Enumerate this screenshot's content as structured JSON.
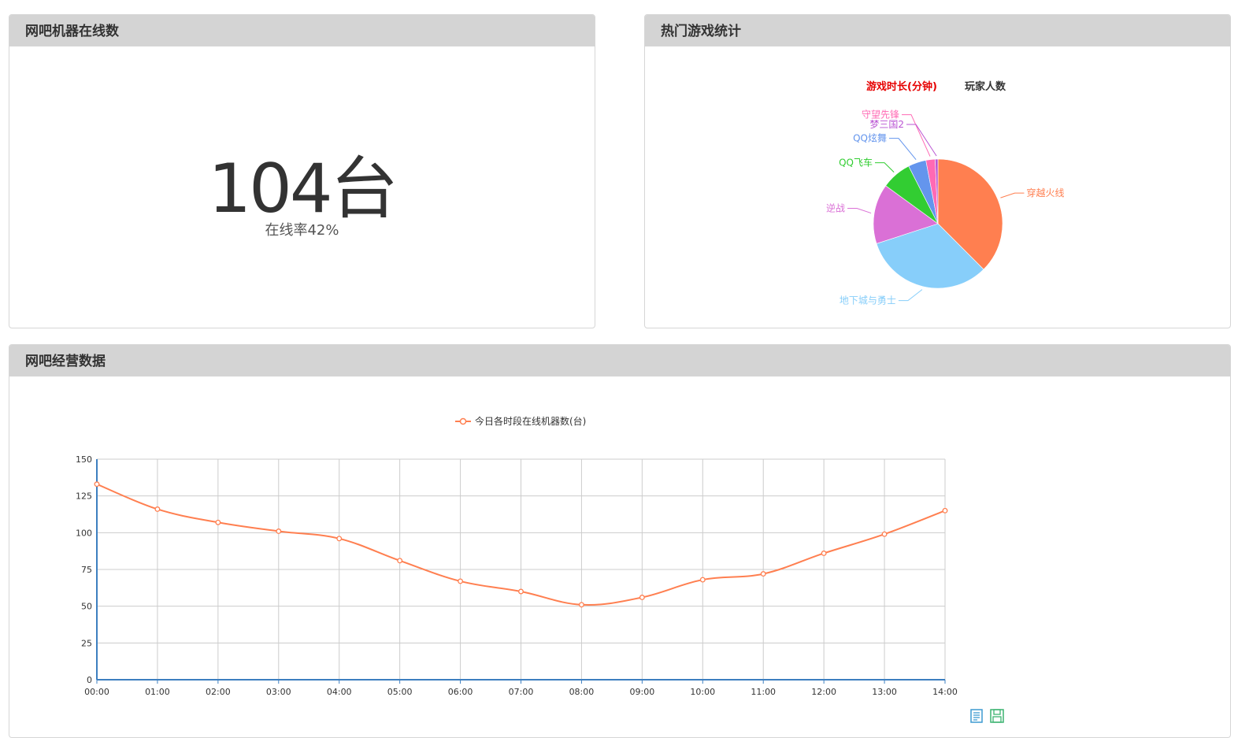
{
  "online_panel": {
    "title": "网吧机器在线数",
    "count": "104台",
    "rate": "在线率42%"
  },
  "games_panel": {
    "title": "热门游戏统计",
    "tabs": [
      {
        "label": "游戏时长(分钟)",
        "active": true,
        "color": "#e60000"
      },
      {
        "label": "玩家人数",
        "active": false,
        "color": "#333333"
      }
    ]
  },
  "ops_panel": {
    "title": "网吧经营数据"
  },
  "toolbox": [
    {
      "name": "data-view-icon",
      "color": "#3d9ad1"
    },
    {
      "name": "save-image-icon",
      "color": "#3cb371"
    }
  ],
  "chart_data": [
    {
      "type": "pie",
      "slices": [
        {
          "label": "穿越火线",
          "value": 37.5,
          "color": "#ff7f50"
        },
        {
          "label": "地下城与勇士",
          "value": 32.5,
          "color": "#87cefa"
        },
        {
          "label": "逆战",
          "value": 15,
          "color": "#da70d6"
        },
        {
          "label": "QQ飞车",
          "value": 7.5,
          "color": "#32cd32"
        },
        {
          "label": "QQ炫舞",
          "value": 4.5,
          "color": "#6495ed"
        },
        {
          "label": "守望先锋",
          "value": 2.3,
          "color": "#ff69b4"
        },
        {
          "label": "梦三国2",
          "value": 0.7,
          "color": "#ba55d3"
        }
      ]
    },
    {
      "type": "line",
      "legend": "今日各时段在线机器数(台)",
      "color": "#ff7f50",
      "x": [
        "00:00",
        "01:00",
        "02:00",
        "03:00",
        "04:00",
        "05:00",
        "06:00",
        "07:00",
        "08:00",
        "09:00",
        "10:00",
        "11:00",
        "12:00",
        "13:00",
        "14:00"
      ],
      "values": [
        133,
        116,
        107,
        101,
        96,
        81,
        67,
        60,
        51,
        56,
        68,
        72,
        86,
        99,
        115
      ],
      "ylim": [
        0,
        150
      ],
      "yticks": [
        0,
        25,
        50,
        75,
        100,
        125,
        150
      ],
      "grid": true,
      "legend_position": "top-center"
    }
  ]
}
